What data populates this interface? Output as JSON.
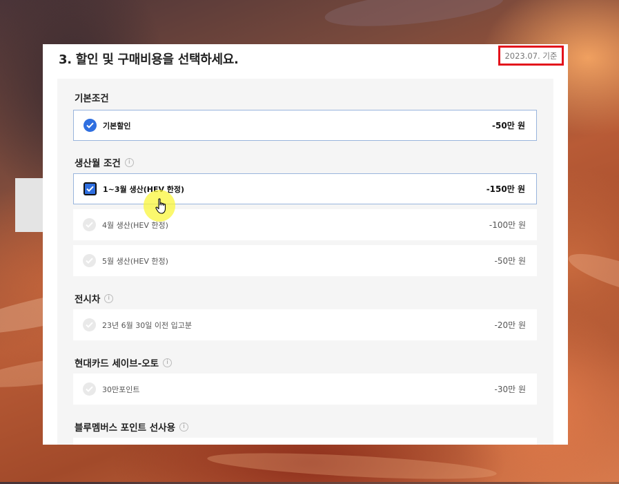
{
  "panel": {
    "title": "3. 할인 및 구매비용을 선택하세요.",
    "date_badge": "2023.07. 기준"
  },
  "sections": [
    {
      "title": "기본조건",
      "info": false,
      "items": [
        {
          "label": "기본할인",
          "price": "-50만 원",
          "checked": true,
          "style": "circle"
        }
      ]
    },
    {
      "title": "생산월 조건",
      "info": true,
      "items": [
        {
          "label": "1~3월 생산(HEV 한정)",
          "price": "-150만 원",
          "checked": true,
          "style": "square"
        },
        {
          "label": "4월 생산(HEV 한정)",
          "price": "-100만 원",
          "checked": false,
          "style": "circle"
        },
        {
          "label": "5월 생산(HEV 한정)",
          "price": "-50만 원",
          "checked": false,
          "style": "circle"
        }
      ]
    },
    {
      "title": "전시차",
      "info": true,
      "items": [
        {
          "label": "23년 6월 30일 이전 입고분",
          "price": "-20만 원",
          "checked": false,
          "style": "circle"
        }
      ]
    },
    {
      "title": "현대카드 세이브-오토",
      "info": true,
      "items": [
        {
          "label": "30만포인트",
          "price": "-30만 원",
          "checked": false,
          "style": "circle"
        }
      ]
    },
    {
      "title": "블루멤버스 포인트 선사용",
      "info": true,
      "items": []
    }
  ],
  "icons": {
    "info": "i",
    "checkmark": "checkmark-icon",
    "cursor": "hand-pointer-icon"
  },
  "colors": {
    "accent": "#2f6fe0",
    "highlight_border": "#e3121b",
    "selected_row_border": "#98b4dc",
    "cursor_highlight": "#faf53c"
  }
}
